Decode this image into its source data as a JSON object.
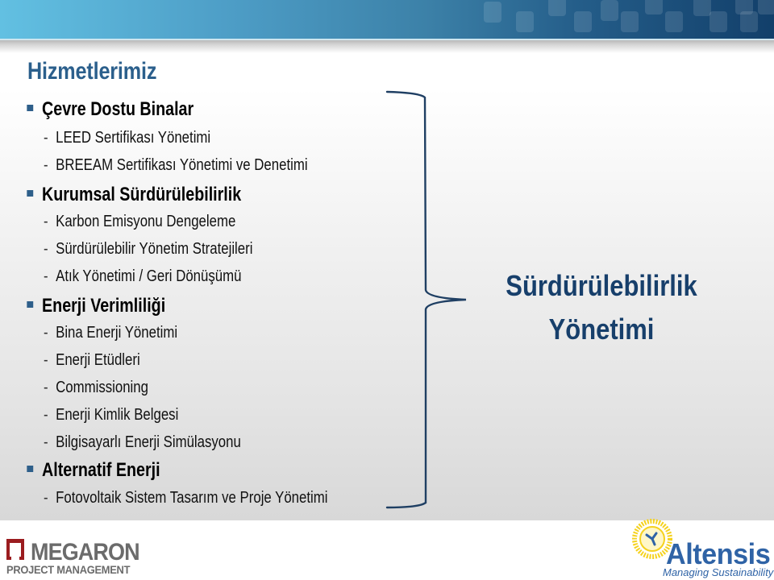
{
  "slide": {
    "title": "Hizmetlerimiz",
    "sections": [
      {
        "heading": "Çevre Dostu Binalar",
        "items": [
          "LEED Sertifikası Yönetimi",
          "BREEAM Sertifikası Yönetimi ve Denetimi"
        ]
      },
      {
        "heading": "Kurumsal Sürdürülebilirlik",
        "items": [
          "Karbon Emisyonu Dengeleme",
          "Sürdürülebilir Yönetim Stratejileri",
          "Atık Yönetimi / Geri Dönüşümü"
        ]
      },
      {
        "heading": "Enerji Verimliliği",
        "items": [
          "Bina Enerji Yönetimi",
          "Enerji Etüdleri",
          "Commissioning",
          "Enerji Kimlik Belgesi",
          "Bilgisayarlı Enerji Simülasyonu"
        ]
      },
      {
        "heading": "Alternatif Enerji",
        "items": [
          "Fotovoltaik Sistem Tasarım ve Proje Yönetimi"
        ]
      }
    ],
    "dash": "-",
    "summary": {
      "line1": "Sürdürülebilirlik",
      "line2": "Yönetimi"
    }
  },
  "footer": {
    "left_logo": {
      "name": "MEGARON",
      "subtitle": "PROJECT MANAGEMENT"
    },
    "right_logo": {
      "name": "Altensis",
      "tagline": "Managing Sustainability"
    }
  },
  "colors": {
    "title": "#2b5f8c",
    "bullet": "#2e5f8a",
    "summary": "#173f6b",
    "bracket": "#1f3f63",
    "megaron_red": "#9b1c1f",
    "megaron_gray": "#6b6b6b",
    "altensis_blue": "#2f63a6",
    "altensis_sun": "#f5d21e"
  }
}
